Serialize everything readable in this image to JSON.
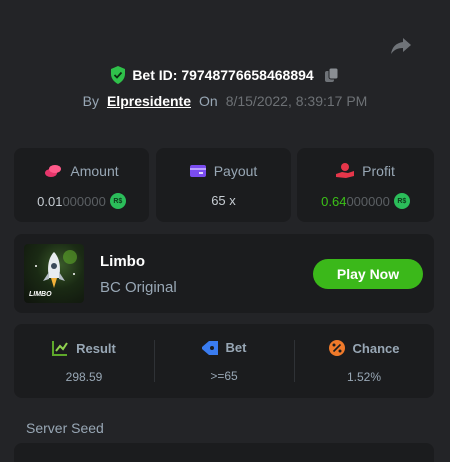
{
  "header": {
    "bet_id_label": "Bet ID: 79748776658468894",
    "by_label": "By",
    "username": "Elpresidente",
    "on_label": "On",
    "date": "8/15/2022, 8:39:17 PM"
  },
  "stats": {
    "amount": {
      "label": "Amount",
      "value_main": "0.01",
      "value_trail": "000000",
      "currency": "R$"
    },
    "payout": {
      "label": "Payout",
      "value": "65 x"
    },
    "profit": {
      "label": "Profit",
      "value_main": "0.64",
      "value_trail": "000000",
      "currency": "R$"
    }
  },
  "game": {
    "thumb_label": "LIMBO",
    "name": "Limbo",
    "subtitle": "BC Original",
    "play_label": "Play Now"
  },
  "result": {
    "result": {
      "label": "Result",
      "value": "298.59"
    },
    "bet": {
      "label": "Bet",
      "value": ">=65"
    },
    "chance": {
      "label": "Chance",
      "value": "1.52%"
    }
  },
  "seed": {
    "label": "Server Seed"
  },
  "colors": {
    "background": "#232427",
    "card": "#1b1c1e",
    "accent_green": "#3bb81a",
    "shield_green": "#2fc04a",
    "amount_icon": "#e6366b",
    "payout_icon": "#7a4cf0",
    "profit_icon": "#e6364a",
    "chance_icon": "#f07a2a",
    "bet_icon": "#3a7cf0"
  },
  "icons": {
    "share": "share-icon",
    "shield": "verified-shield-icon",
    "copy": "copy-icon",
    "amount": "coins-icon",
    "payout": "wallet-icon",
    "profit": "hand-coin-icon",
    "result": "chart-check-icon",
    "bet": "ticket-icon",
    "chance": "percent-icon",
    "game": "rocket-icon"
  }
}
